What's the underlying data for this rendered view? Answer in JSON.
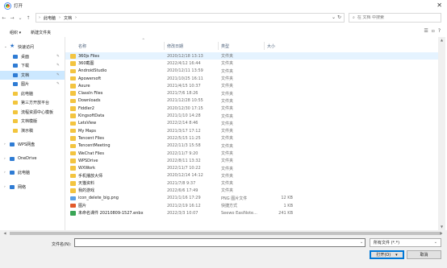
{
  "window": {
    "title": "打开",
    "close_glyph": "✕"
  },
  "nav": {
    "back": "←",
    "forward": "→",
    "dropdown": "⌄",
    "up": "↑"
  },
  "address": {
    "segments": [
      "此电脑",
      "文档"
    ],
    "separator": "›",
    "dropdown": "⌄",
    "refresh": "↻"
  },
  "search": {
    "placeholder": "在 文档 中搜索",
    "icon": "⌕"
  },
  "toolbar": {
    "organize": "组织 ▾",
    "new_folder": "新建文件夹",
    "view_icons": [
      "☰",
      "▫",
      "?"
    ]
  },
  "sidebar": {
    "items": [
      {
        "label": "快速访问",
        "level": 0,
        "icon": "star",
        "arrow": "⌄",
        "pinned": false,
        "selected": false
      },
      {
        "label": "桌面",
        "level": 1,
        "icon": "blue",
        "pinned": true,
        "selected": false
      },
      {
        "label": "下载",
        "level": 1,
        "icon": "blue",
        "pinned": true,
        "selected": false
      },
      {
        "label": "文档",
        "level": 1,
        "icon": "blue",
        "pinned": true,
        "selected": true
      },
      {
        "label": "图片",
        "level": 1,
        "icon": "blue",
        "pinned": true,
        "selected": false
      },
      {
        "label": "此电脑",
        "level": 1,
        "icon": "fold",
        "pinned": false,
        "selected": false
      },
      {
        "label": "第三方开放平台",
        "level": 1,
        "icon": "fold",
        "pinned": false,
        "selected": false
      },
      {
        "label": "流程资源中心模板",
        "level": 1,
        "icon": "fold",
        "pinned": false,
        "selected": false
      },
      {
        "label": "文档模版",
        "level": 1,
        "icon": "fold",
        "pinned": false,
        "selected": false
      },
      {
        "label": "演示稿",
        "level": 1,
        "icon": "fold",
        "pinned": false,
        "selected": false
      },
      {
        "label": "",
        "level": 0,
        "spacer": true
      },
      {
        "label": "WPS网盘",
        "level": 0,
        "icon": "blue",
        "arrow": "›",
        "pinned": false,
        "selected": false
      },
      {
        "label": "",
        "level": 0,
        "spacer": true
      },
      {
        "label": "OneDrive",
        "level": 0,
        "icon": "blue",
        "arrow": "›",
        "pinned": false,
        "selected": false
      },
      {
        "label": "",
        "level": 0,
        "spacer": true
      },
      {
        "label": "此电脑",
        "level": 0,
        "icon": "blue",
        "arrow": "›",
        "pinned": false,
        "selected": false
      },
      {
        "label": "",
        "level": 0,
        "spacer": true
      },
      {
        "label": "网络",
        "level": 0,
        "icon": "blue",
        "arrow": "›",
        "pinned": false,
        "selected": false
      }
    ],
    "pin_glyph": "✎"
  },
  "columns": {
    "name": "名称",
    "date": "修改日期",
    "type": "类型",
    "size": "大小",
    "sort_glyph": "^"
  },
  "files": [
    {
      "name": "360js Files",
      "date": "2020/12/18 13:13",
      "type": "文件夹",
      "size": "",
      "icon": "folder",
      "selected": true
    },
    {
      "name": "360截图",
      "date": "2022/4/12 16:44",
      "type": "文件夹",
      "size": "",
      "icon": "folder"
    },
    {
      "name": "AndroidStudio",
      "date": "2020/12/11 13:59",
      "type": "文件夹",
      "size": "",
      "icon": "folder"
    },
    {
      "name": "Apowersoft",
      "date": "2021/10/25 16:11",
      "type": "文件夹",
      "size": "",
      "icon": "folder"
    },
    {
      "name": "Axure",
      "date": "2021/4/15 10:37",
      "type": "文件夹",
      "size": "",
      "icon": "folder"
    },
    {
      "name": "ClassIn Files",
      "date": "2021/7/6 18:26",
      "type": "文件夹",
      "size": "",
      "icon": "folder"
    },
    {
      "name": "Downloads",
      "date": "2021/12/28 10:55",
      "type": "文件夹",
      "size": "",
      "icon": "folder"
    },
    {
      "name": "Fiddler2",
      "date": "2020/12/30 17:15",
      "type": "文件夹",
      "size": "",
      "icon": "folder"
    },
    {
      "name": "KingsoftData",
      "date": "2021/1/10 14:28",
      "type": "文件夹",
      "size": "",
      "icon": "folder"
    },
    {
      "name": "LetsView",
      "date": "2022/2/14 8:46",
      "type": "文件夹",
      "size": "",
      "icon": "folder"
    },
    {
      "name": "My Maps",
      "date": "2021/3/17 17:12",
      "type": "文件夹",
      "size": "",
      "icon": "folder"
    },
    {
      "name": "Tencent Files",
      "date": "2022/5/15 11:25",
      "type": "文件夹",
      "size": "",
      "icon": "folder"
    },
    {
      "name": "TencentMeeting",
      "date": "2022/11/3 15:58",
      "type": "文件夹",
      "size": "",
      "icon": "folder"
    },
    {
      "name": "WeChat Files",
      "date": "2022/11/7 9:20",
      "type": "文件夹",
      "size": "",
      "icon": "folder"
    },
    {
      "name": "WPSDrive",
      "date": "2022/8/11 13:32",
      "type": "文件夹",
      "size": "",
      "icon": "folder"
    },
    {
      "name": "WXWork",
      "date": "2022/11/7 10:22",
      "type": "文件夹",
      "size": "",
      "icon": "folder"
    },
    {
      "name": "手机播放大师",
      "date": "2020/12/14 14:12",
      "type": "文件夹",
      "size": "",
      "icon": "folder"
    },
    {
      "name": "天猫资料",
      "date": "2021/7/8 9:37",
      "type": "文件夹",
      "size": "",
      "icon": "folder"
    },
    {
      "name": "我的游戏",
      "date": "2022/6/6 17:49",
      "type": "文件夹",
      "size": "",
      "icon": "folder"
    },
    {
      "name": "icon_delete_big.png",
      "date": "2021/1/16 17:29",
      "type": "PNG 图片文件",
      "size": "12 KB",
      "icon": "img"
    },
    {
      "name": "图片",
      "date": "2021/2/19 16:12",
      "type": "快捷方式",
      "size": "1 KB",
      "icon": "exe"
    },
    {
      "name": "未命名课件 20210809-1527.enbx",
      "date": "2022/3/3 10:07",
      "type": "Seewo EasiNote...",
      "size": "241 KB",
      "icon": "enbx"
    }
  ],
  "bottom": {
    "filename_label": "文件名(N):",
    "filename_value": "",
    "filetype_value": "所有文件 (*.*)",
    "open_label": "打开(O)",
    "open_caret": "▾",
    "cancel_label": "取消"
  },
  "colors": {
    "selection": "#cce8ff",
    "folder": "#f3c440",
    "accent": "#0078d7"
  }
}
